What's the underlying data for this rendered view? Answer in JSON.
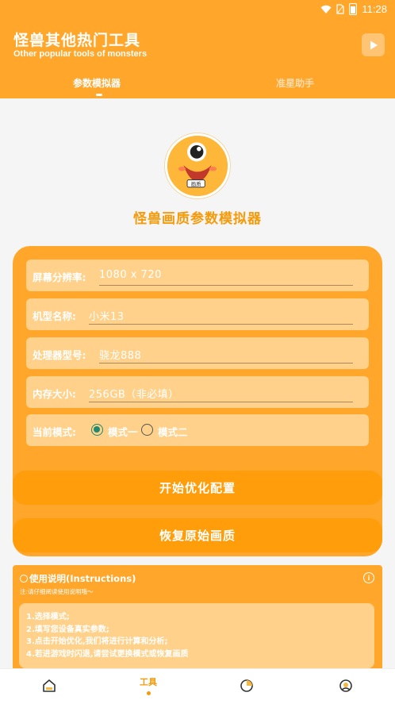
{
  "status_bar": {
    "time": "11:28"
  },
  "header": {
    "title": "怪兽其他热门工具",
    "subtitle": "Other popular tools of monsters",
    "tabs": [
      {
        "label": "参数模拟器",
        "active": true
      },
      {
        "label": "准星助手",
        "active": false
      }
    ]
  },
  "main": {
    "logo_badge": "画质",
    "title": "怪兽画质参数模拟器",
    "fields": [
      {
        "label": "屏幕分辨率:",
        "placeholder": "1080 x 720"
      },
      {
        "label": "机型名称:",
        "placeholder": "小米13"
      },
      {
        "label": "处理器型号:",
        "placeholder": "骁龙888"
      },
      {
        "label": "内存大小:",
        "placeholder": "256GB（非必填）"
      }
    ],
    "mode": {
      "label": "当前模式:",
      "options": [
        "模式一",
        "模式二"
      ],
      "selected": "模式一"
    },
    "start_button": "开始优化配置",
    "restore_button": "恢复原始画质",
    "instructions": {
      "title": "使用说明(Instructions)",
      "note": "注:请仔细阅读使用说明哦～",
      "lines": [
        "1.选择模式;",
        "2.填写您设备真实参数;",
        "3.点击开始优化,我们将进行计算和分析;",
        "4.若进游戏时闪退,请尝试更换模式或恢复画质"
      ]
    }
  },
  "bottom_nav": {
    "tools_label": "工具",
    "items": [
      "home-icon",
      "tools",
      "pie-chart-icon",
      "profile-icon"
    ]
  },
  "colors": {
    "brand": "#ffa62b",
    "accent": "#ff9d0a",
    "field_bg": "#ffd18a",
    "radio_on": "#1f8a70"
  }
}
